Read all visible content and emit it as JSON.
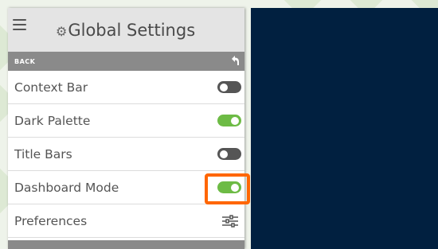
{
  "header": {
    "menu_icon": "hamburger-icon",
    "gear_icon": "gear-icon",
    "title": "Global Settings"
  },
  "backbar": {
    "label": "BACK",
    "icon": "undo-arrow-icon"
  },
  "settings": [
    {
      "label": "Context Bar",
      "state": "off"
    },
    {
      "label": "Dark Palette",
      "state": "on"
    },
    {
      "label": "Title Bars",
      "state": "off"
    },
    {
      "label": "Dashboard Mode",
      "state": "on"
    },
    {
      "label": "Preferences",
      "icon": "sliders-icon"
    }
  ],
  "colors": {
    "toggle_on": "#6dbb45",
    "toggle_off": "#555555",
    "highlight": "#ff6600",
    "dark_pane": "#012040"
  }
}
